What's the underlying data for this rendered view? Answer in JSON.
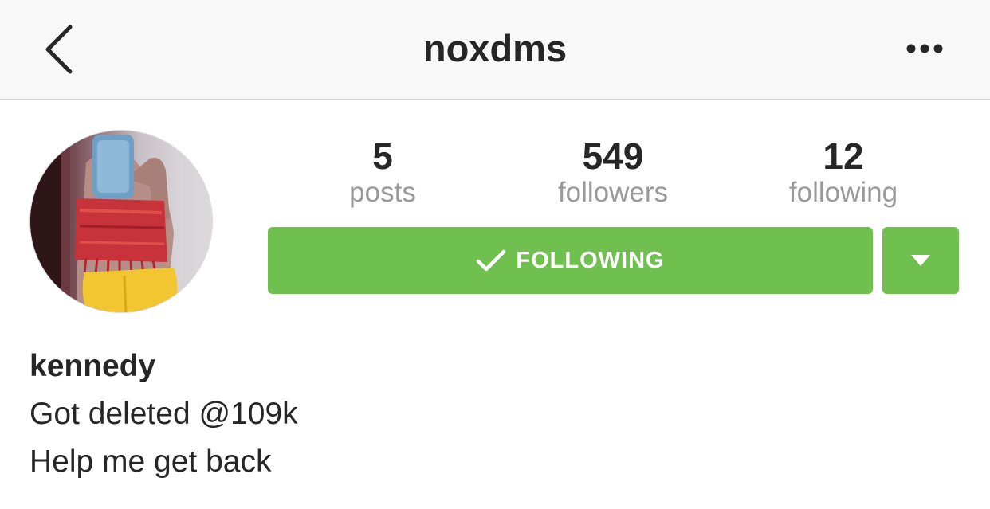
{
  "navbar": {
    "back_icon": "chevron-left-icon",
    "title": "noxdms",
    "more_icon": "ellipsis-icon"
  },
  "profile": {
    "avatar_icon": "profile-photo",
    "stats": {
      "posts": {
        "count": "5",
        "label": "posts"
      },
      "followers": {
        "count": "549",
        "label": "followers"
      },
      "following": {
        "count": "12",
        "label": "following"
      }
    },
    "follow_button": {
      "icon": "checkmark-icon",
      "label": "FOLLOWING",
      "color": "#70c050"
    },
    "dropdown_button": {
      "icon": "caret-down-icon",
      "color": "#70c050"
    },
    "bio": {
      "name": "kennedy",
      "lines": [
        "Got deleted @109k",
        "Help me get back"
      ]
    }
  }
}
